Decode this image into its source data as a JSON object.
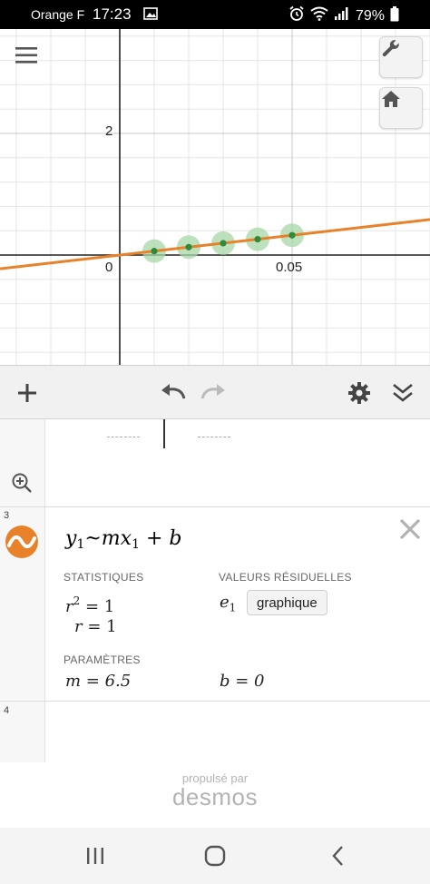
{
  "status_bar": {
    "carrier": "Orange F",
    "time": "17:23",
    "battery": "79%"
  },
  "graph": {
    "x_tick": "0.05",
    "y_tick": "2",
    "origin_label": "0",
    "line_color": "#e8822a",
    "point_color": "#2e8b3c",
    "highlight_color": "#a7d7a5",
    "points": [
      {
        "x": 0.01,
        "y": 0.065
      },
      {
        "x": 0.02,
        "y": 0.13
      },
      {
        "x": 0.03,
        "y": 0.195
      },
      {
        "x": 0.04,
        "y": 0.26
      },
      {
        "x": 0.05,
        "y": 0.325
      }
    ],
    "line": {
      "slope": 6.5,
      "intercept": 0
    }
  },
  "toolbar": {
    "add_icon": "plus-icon",
    "undo_icon": "undo-icon",
    "redo_icon": "redo-icon",
    "settings_icon": "gear-icon",
    "collapse_icon": "double-chevron-down-icon"
  },
  "expressions": {
    "row_3_number": "3",
    "row_4_number": "4",
    "regression": {
      "formula_y": "y",
      "formula_y_sub": "1",
      "formula_tilde": "~",
      "formula_mx": "mx",
      "formula_x_sub": "1",
      "formula_plus": "+ b",
      "stats_label": "STATISTIQUES",
      "residuals_label": "VALEURS RÉSIDUELLES",
      "r2_text": "= 1",
      "r_text": "= 1",
      "residual_var": "e",
      "residual_sub": "1",
      "graph_button": "graphique",
      "params_label": "PARAMÈTRES",
      "m_text": "m = 6.5",
      "b_text": "b = 0"
    }
  },
  "footer": {
    "powered_by": "propulsé par",
    "brand": "desmos"
  }
}
